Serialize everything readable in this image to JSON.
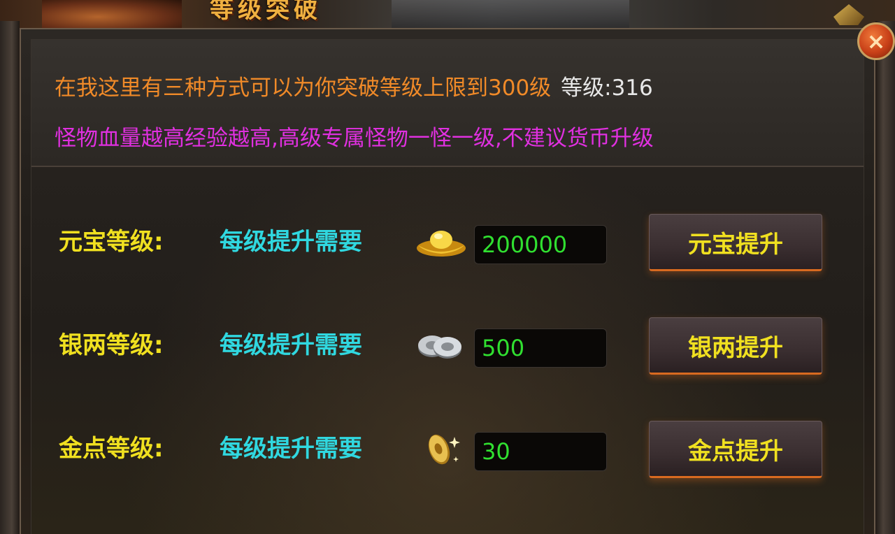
{
  "window": {
    "title": "等级突破",
    "close_label": "×"
  },
  "info": {
    "intro": "在我这里有三种方式可以为你突破等级上限到300级",
    "level": "等级:316",
    "tip": "怪物血量越高经验越高,高级专属怪物一怪一级,不建议货币升级"
  },
  "rows": [
    {
      "label": "元宝等级:",
      "desc": "每级提升需要",
      "icon": "gold-ingot-icon",
      "value": "200000",
      "button": "元宝提升"
    },
    {
      "label": "银两等级:",
      "desc": "每级提升需要",
      "icon": "silver-coins-icon",
      "value": "500",
      "button": "银两提升"
    },
    {
      "label": "金点等级:",
      "desc": "每级提升需要",
      "icon": "gold-point-icon",
      "value": "30",
      "button": "金点提升"
    }
  ],
  "colors": {
    "intro": "#f08a28",
    "tip": "#e030e0",
    "label": "#f0e020",
    "desc": "#30d8e0",
    "value": "#30e030"
  }
}
